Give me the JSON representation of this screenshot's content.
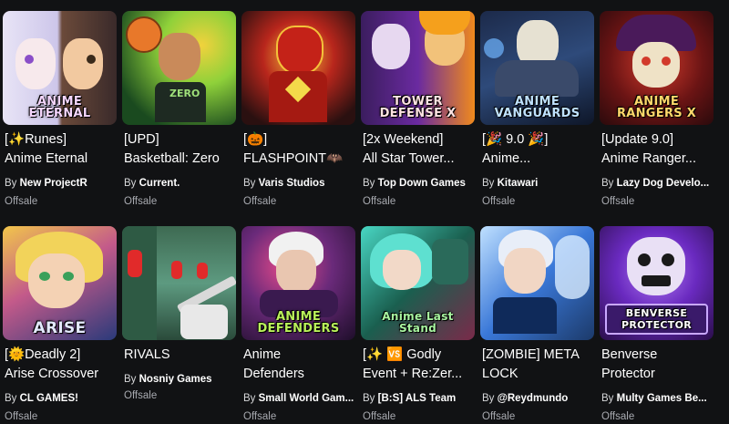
{
  "games": [
    {
      "title_l1": "[✨Runes]",
      "title_l2": "Anime Eternal",
      "by": "By",
      "creator": "New ProjectR",
      "status": "Offsale",
      "logo": "ANIME ETERNAL",
      "colors": [
        "#d7d3ef",
        "#5a3f8f",
        "#f0b9d0"
      ]
    },
    {
      "title_l1": "[UPD]",
      "title_l2": "Basketball: Zero",
      "by": "By",
      "creator": "Current.",
      "status": "Offsale",
      "logo": "",
      "colors": [
        "#1a4a1f",
        "#8fd13a",
        "#f1d23c"
      ]
    },
    {
      "title_l1": "[🎃]",
      "title_l2": "FLASHPOINT🦇",
      "by": "By",
      "creator": "Varis Studios",
      "status": "Offsale",
      "logo": "",
      "colors": [
        "#2a1010",
        "#d22a1f",
        "#f4c23a"
      ]
    },
    {
      "title_l1": "[2x Weekend]",
      "title_l2": "All Star Tower...",
      "by": "By",
      "creator": "Top Down Games",
      "status": "Offsale",
      "logo": "TOWER DEFENSE X",
      "colors": [
        "#3b1d5e",
        "#f08a1c",
        "#8e40d8"
      ]
    },
    {
      "title_l1": "[🎉 9.0 🎉]",
      "title_l2": "Anime...",
      "by": "By",
      "creator": "Kitawari",
      "status": "Offsale",
      "logo": "ANIME VANGUARDS",
      "colors": [
        "#1c2a4a",
        "#6fb5ff",
        "#e6e1d2"
      ]
    },
    {
      "title_l1": "[Update 9.0]",
      "title_l2": "Anime Ranger...",
      "by": "By",
      "creator": "Lazy Dog Develo...",
      "status": "Offsale",
      "logo": "ANIME RANGERS X",
      "colors": [
        "#3a0f12",
        "#d23a2b",
        "#f3cf6b"
      ]
    },
    {
      "title_l1": "[🌞Deadly 2]",
      "title_l2": "Arise Crossover",
      "by": "By",
      "creator": "CL GAMES!",
      "status": "Offsale",
      "logo": "ARISE",
      "colors": [
        "#2a3a7a",
        "#f2c64a",
        "#c35a8a"
      ]
    },
    {
      "title_l1": "RIVALS",
      "title_l2": "",
      "by": "By",
      "creator": "Nosniy Games",
      "status": "Offsale",
      "logo": "",
      "colors": [
        "#1f3a2a",
        "#e12a2a",
        "#6fd1a8"
      ]
    },
    {
      "title_l1": "Anime",
      "title_l2": "Defenders",
      "by": "By",
      "creator": "Small World Gam...",
      "status": "Offsale",
      "logo": "ANIME DEFENDERS",
      "colors": [
        "#3a1a4f",
        "#9fd23a",
        "#e64a8a"
      ]
    },
    {
      "title_l1": "[✨ 🆚 Godly",
      "title_l2": "Event + Re:Zer...",
      "by": "By",
      "creator": "[B:S] ALS Team",
      "status": "Offsale",
      "logo": "Anime Last Stand",
      "colors": [
        "#1a5f4f",
        "#48d6c3",
        "#e3508a"
      ]
    },
    {
      "title_l1": "[ZOMBIE] META",
      "title_l2": "LOCK",
      "by": "By",
      "creator": "@Reydmundo",
      "status": "Offsale",
      "logo": "",
      "colors": [
        "#1c3a6a",
        "#bfe0ff",
        "#3a78d8"
      ]
    },
    {
      "title_l1": "Benverse",
      "title_l2": "Protector",
      "by": "By",
      "creator": "Multy Games Be...",
      "status": "Offsale",
      "logo": "BENVERSE PROTECTOR",
      "colors": [
        "#3a1a6a",
        "#8a3ae0",
        "#e9e0f5"
      ]
    }
  ]
}
